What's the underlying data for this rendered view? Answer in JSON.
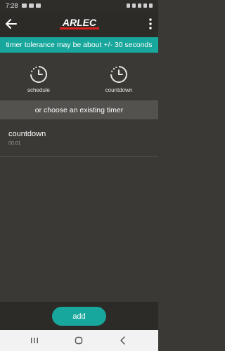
{
  "status_bar": {
    "time": "7:28"
  },
  "app_bar": {
    "logo_text": "ARLEC"
  },
  "notice": {
    "text": "timer tolerance may be about +/- 30 seconds"
  },
  "timer_types": [
    {
      "label": "schedule",
      "icon": "timer-icon"
    },
    {
      "label": "countdown",
      "icon": "timer-icon"
    }
  ],
  "existing": {
    "header": "or choose an existing timer"
  },
  "timers": [
    {
      "name": "countdown",
      "duration": "00:01"
    }
  ],
  "actions": {
    "add_label": "add"
  },
  "colors": {
    "accent": "#18a79c",
    "background": "#3b3935",
    "logo_red": "#e0201f"
  }
}
